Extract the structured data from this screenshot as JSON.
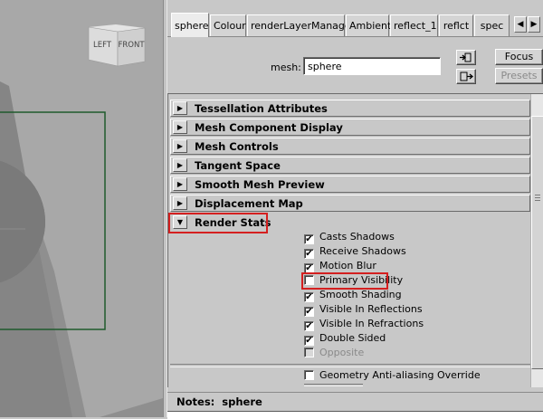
{
  "viewcube": {
    "left_label": "LEFT",
    "front_label": "FRONT"
  },
  "tabs": [
    {
      "label": "sphere",
      "active": true
    },
    {
      "label": "Colour"
    },
    {
      "label": "renderLayerManager"
    },
    {
      "label": "Ambient"
    },
    {
      "label": "reflect_1"
    },
    {
      "label": "reflct"
    },
    {
      "label": "spec"
    }
  ],
  "tab_nav": {
    "left_icon": "triangle-left-icon",
    "right_icon": "triangle-right-icon"
  },
  "mesh": {
    "label": "mesh:",
    "value": "sphere"
  },
  "buttons": {
    "focus": "Focus",
    "presets": "Presets",
    "load_icon": "load-attributes-icon",
    "copy_icon": "copy-tab-icon"
  },
  "sections": [
    {
      "title": "Tessellation Attributes",
      "expanded": false
    },
    {
      "title": "Mesh Component Display",
      "expanded": false
    },
    {
      "title": "Mesh Controls",
      "expanded": false
    },
    {
      "title": "Tangent Space",
      "expanded": false
    },
    {
      "title": "Smooth Mesh Preview",
      "expanded": false
    },
    {
      "title": "Displacement Map",
      "expanded": false
    },
    {
      "title": "Render Stats",
      "expanded": true
    }
  ],
  "render_stats": [
    {
      "label": "Casts Shadows",
      "checked": true
    },
    {
      "label": "Receive Shadows",
      "checked": true
    },
    {
      "label": "Motion Blur",
      "checked": true
    },
    {
      "label": "Primary Visibility",
      "checked": false
    },
    {
      "label": "Smooth Shading",
      "checked": true
    },
    {
      "label": "Visible In Reflections",
      "checked": true
    },
    {
      "label": "Visible In Refractions",
      "checked": true
    },
    {
      "label": "Double Sided",
      "checked": true
    },
    {
      "label": "Opposite",
      "checked": false,
      "disabled": true
    }
  ],
  "geometry_aa": {
    "label": "Geometry Anti-aliasing Override",
    "checked": false
  },
  "notes": {
    "label": "Notes:",
    "value": "sphere"
  },
  "colors": {
    "highlight": "#d42020",
    "bounding_box": "#1f5a2c"
  }
}
